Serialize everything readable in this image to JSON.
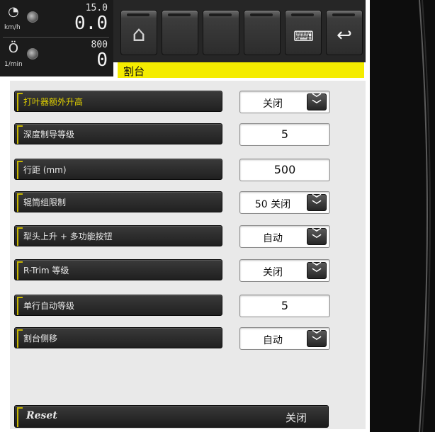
{
  "header": {
    "speed": {
      "unit": "km/h",
      "max": "15.0",
      "value": "0.0"
    },
    "rpm": {
      "unit": "1/min",
      "max": "800",
      "value": "0"
    },
    "page_title": "割台"
  },
  "toolbar": {
    "buttons": [
      "home",
      "blank",
      "blank",
      "blank",
      "keyboard",
      "back"
    ]
  },
  "settings": [
    {
      "label": "打叶器额外升高",
      "value": "关闭",
      "type": "dropdown",
      "active": true
    },
    {
      "label": "深度制导等级",
      "value": "5",
      "type": "number"
    },
    {
      "label": "行距 (mm)",
      "value": "500",
      "type": "number"
    },
    {
      "label": "辊筒组限制",
      "value": "50 关闭",
      "type": "dropdown"
    },
    {
      "label": "犁头上升 + 多功能按钮",
      "value": "自动",
      "type": "dropdown"
    },
    {
      "label": "R-Trim 等级",
      "value": "关闭",
      "type": "dropdown"
    },
    {
      "label": "单行自动等级",
      "value": "5",
      "type": "number"
    },
    {
      "label": "割台侧移",
      "value": "自动",
      "type": "dropdown"
    }
  ],
  "reset": {
    "label": "Reset",
    "state": "关闭"
  },
  "colors": {
    "accent_yellow": "#f4ec00",
    "label_yellow": "#e0d000"
  }
}
